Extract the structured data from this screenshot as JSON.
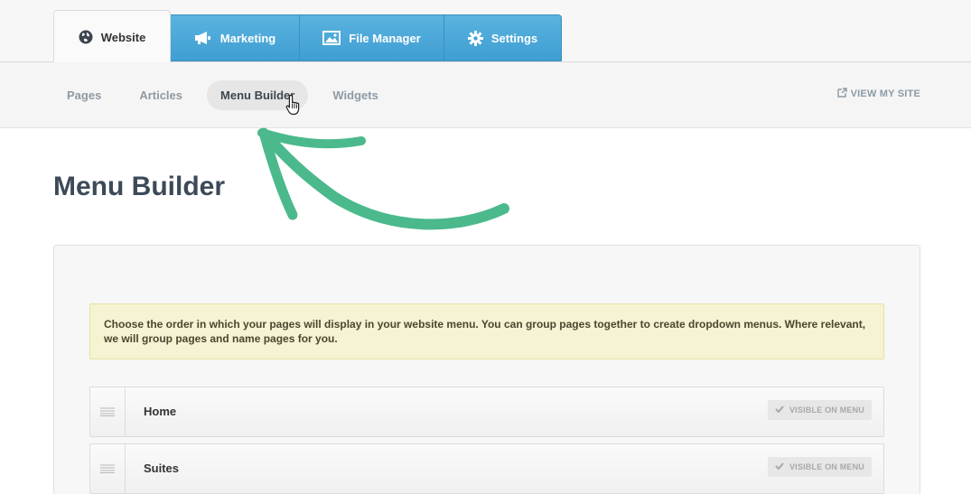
{
  "main_tabs": [
    {
      "label": "Website",
      "icon": "globe-icon",
      "active": true
    },
    {
      "label": "Marketing",
      "icon": "megaphone-icon",
      "active": false
    },
    {
      "label": "File Manager",
      "icon": "image-icon",
      "active": false
    },
    {
      "label": "Settings",
      "icon": "gear-icon",
      "active": false
    }
  ],
  "sub_nav": [
    {
      "label": "Pages",
      "active": false
    },
    {
      "label": "Articles",
      "active": false
    },
    {
      "label": "Menu Builder",
      "active": true
    },
    {
      "label": "Widgets",
      "active": false
    }
  ],
  "view_site": {
    "label": "VIEW MY SITE",
    "icon": "external-link-icon"
  },
  "page_title": "Menu Builder",
  "notice": "Choose the order in which your pages will display in your website menu. You can group pages together to create dropdown menus. Where relevant, we will group pages and name pages for you.",
  "menu_items": [
    {
      "label": "Home",
      "status": "VISIBLE ON MENU"
    },
    {
      "label": "Suites",
      "status": "VISIBLE ON MENU"
    }
  ],
  "colors": {
    "tab_blue": "#4aa8d8",
    "arrow_green": "#4bb98c",
    "notice_bg": "#f5f3d1",
    "title": "#3c4a58"
  }
}
